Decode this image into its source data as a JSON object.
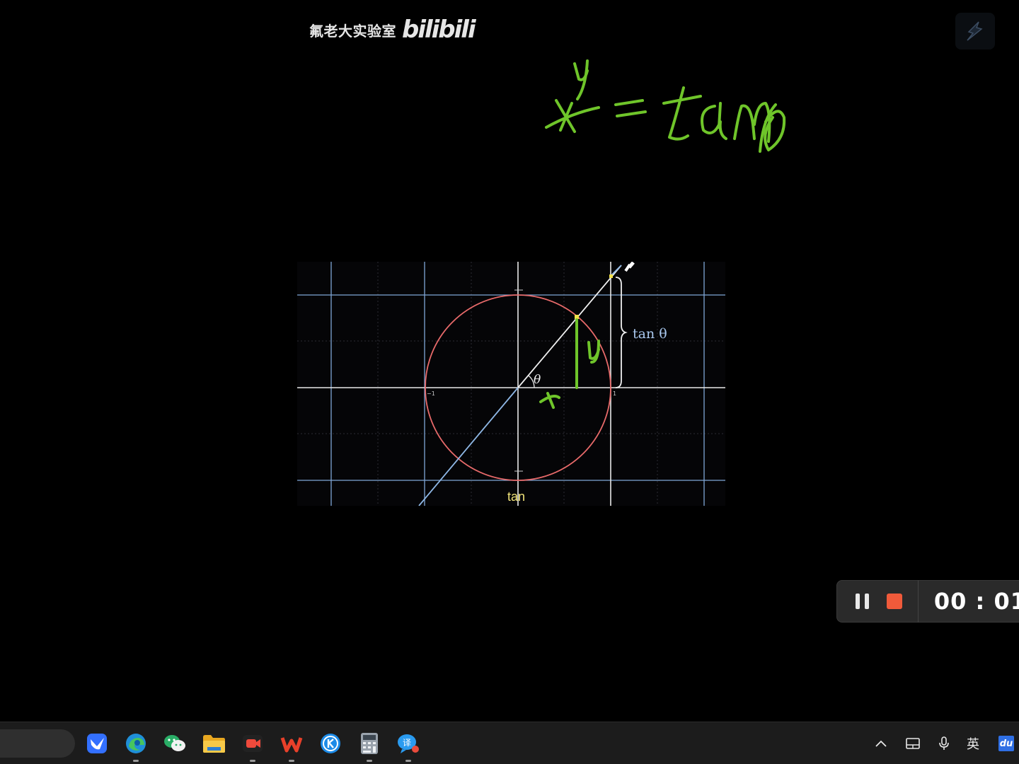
{
  "watermark": {
    "channel_name": "氟老大实验室",
    "logo_text": "bilibili"
  },
  "figure": {
    "tan_theta_label": "tan θ",
    "theta_label": "θ",
    "caption": "tan",
    "tick_neg1_left": "−1",
    "tick_1_right": "1"
  },
  "handwriting": {
    "color": "#6fc52a",
    "x_label": "x",
    "y_label": "y"
  },
  "recorder": {
    "timer": "00 : 01",
    "stop_color": "#f05a3a"
  },
  "taskbar": {
    "apps": [
      {
        "name": "feishu-icon"
      },
      {
        "name": "edge-icon"
      },
      {
        "name": "wechat-icon"
      },
      {
        "name": "file-explorer-icon"
      },
      {
        "name": "screen-recorder-icon"
      },
      {
        "name": "wps-icon"
      },
      {
        "name": "kugou-icon"
      },
      {
        "name": "calculator-icon"
      },
      {
        "name": "translate-icon"
      }
    ],
    "ime_label": "英",
    "baidu_label": "du"
  }
}
